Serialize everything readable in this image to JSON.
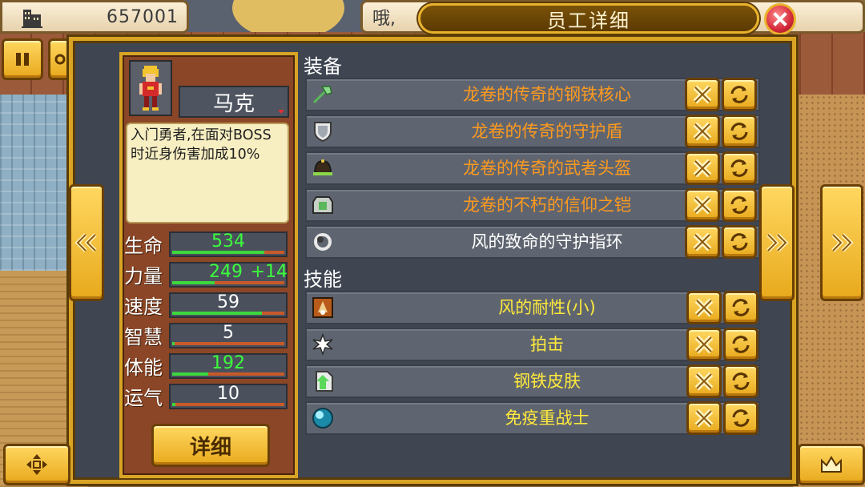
{
  "hud": {
    "money": "657001",
    "message": "哦,",
    "title": "员工详细"
  },
  "character": {
    "name": "马克",
    "description": "入门勇者,在面对BOSS时近身伤害加成10%",
    "stats": [
      {
        "label": "生命",
        "value": "534",
        "bonus": "",
        "value_color": "green",
        "bar": 0.82
      },
      {
        "label": "力量",
        "value": "249",
        "bonus": "+14",
        "value_color": "green",
        "bar": 0.38
      },
      {
        "label": "速度",
        "value": "59",
        "bonus": "",
        "value_color": "white",
        "bar": 0.8
      },
      {
        "label": "智慧",
        "value": "5",
        "bonus": "",
        "value_color": "white",
        "bar": 0.02
      },
      {
        "label": "体能",
        "value": "192",
        "bonus": "",
        "value_color": "green",
        "bar": 0.32
      },
      {
        "label": "运气",
        "value": "10",
        "bonus": "",
        "value_color": "white",
        "bar": 0.03
      }
    ],
    "detail_button": "详细"
  },
  "equipment": {
    "title": "装备",
    "items": [
      {
        "name": "龙卷的传奇的钢铁核心",
        "icon": "axe-icon",
        "color": "orange"
      },
      {
        "name": "龙卷的传奇的守护盾",
        "icon": "shield-icon",
        "color": "orange"
      },
      {
        "name": "龙卷的传奇的武者头盔",
        "icon": "helmet-icon",
        "color": "orange"
      },
      {
        "name": "龙卷的不朽的信仰之铠",
        "icon": "armor-icon",
        "color": "orange"
      },
      {
        "name": "风的致命的守护指环",
        "icon": "ring-icon",
        "color": "white"
      }
    ]
  },
  "skills": {
    "title": "技能",
    "items": [
      {
        "name": "风的耐性(小)",
        "icon": "wind-resist-icon",
        "color": "yellow"
      },
      {
        "name": "拍击",
        "icon": "strike-icon",
        "color": "yellow"
      },
      {
        "name": "钢铁皮肤",
        "icon": "steel-skin-icon",
        "color": "yellow"
      },
      {
        "name": "免疫重战士",
        "icon": "orb-icon",
        "color": "yellow"
      }
    ]
  },
  "colors": {
    "gold": "#d9a424",
    "panel": "#3f4652",
    "orange_text": "#ff9a1e",
    "yellow_text": "#ffea3c",
    "green_text": "#3cff3c"
  }
}
